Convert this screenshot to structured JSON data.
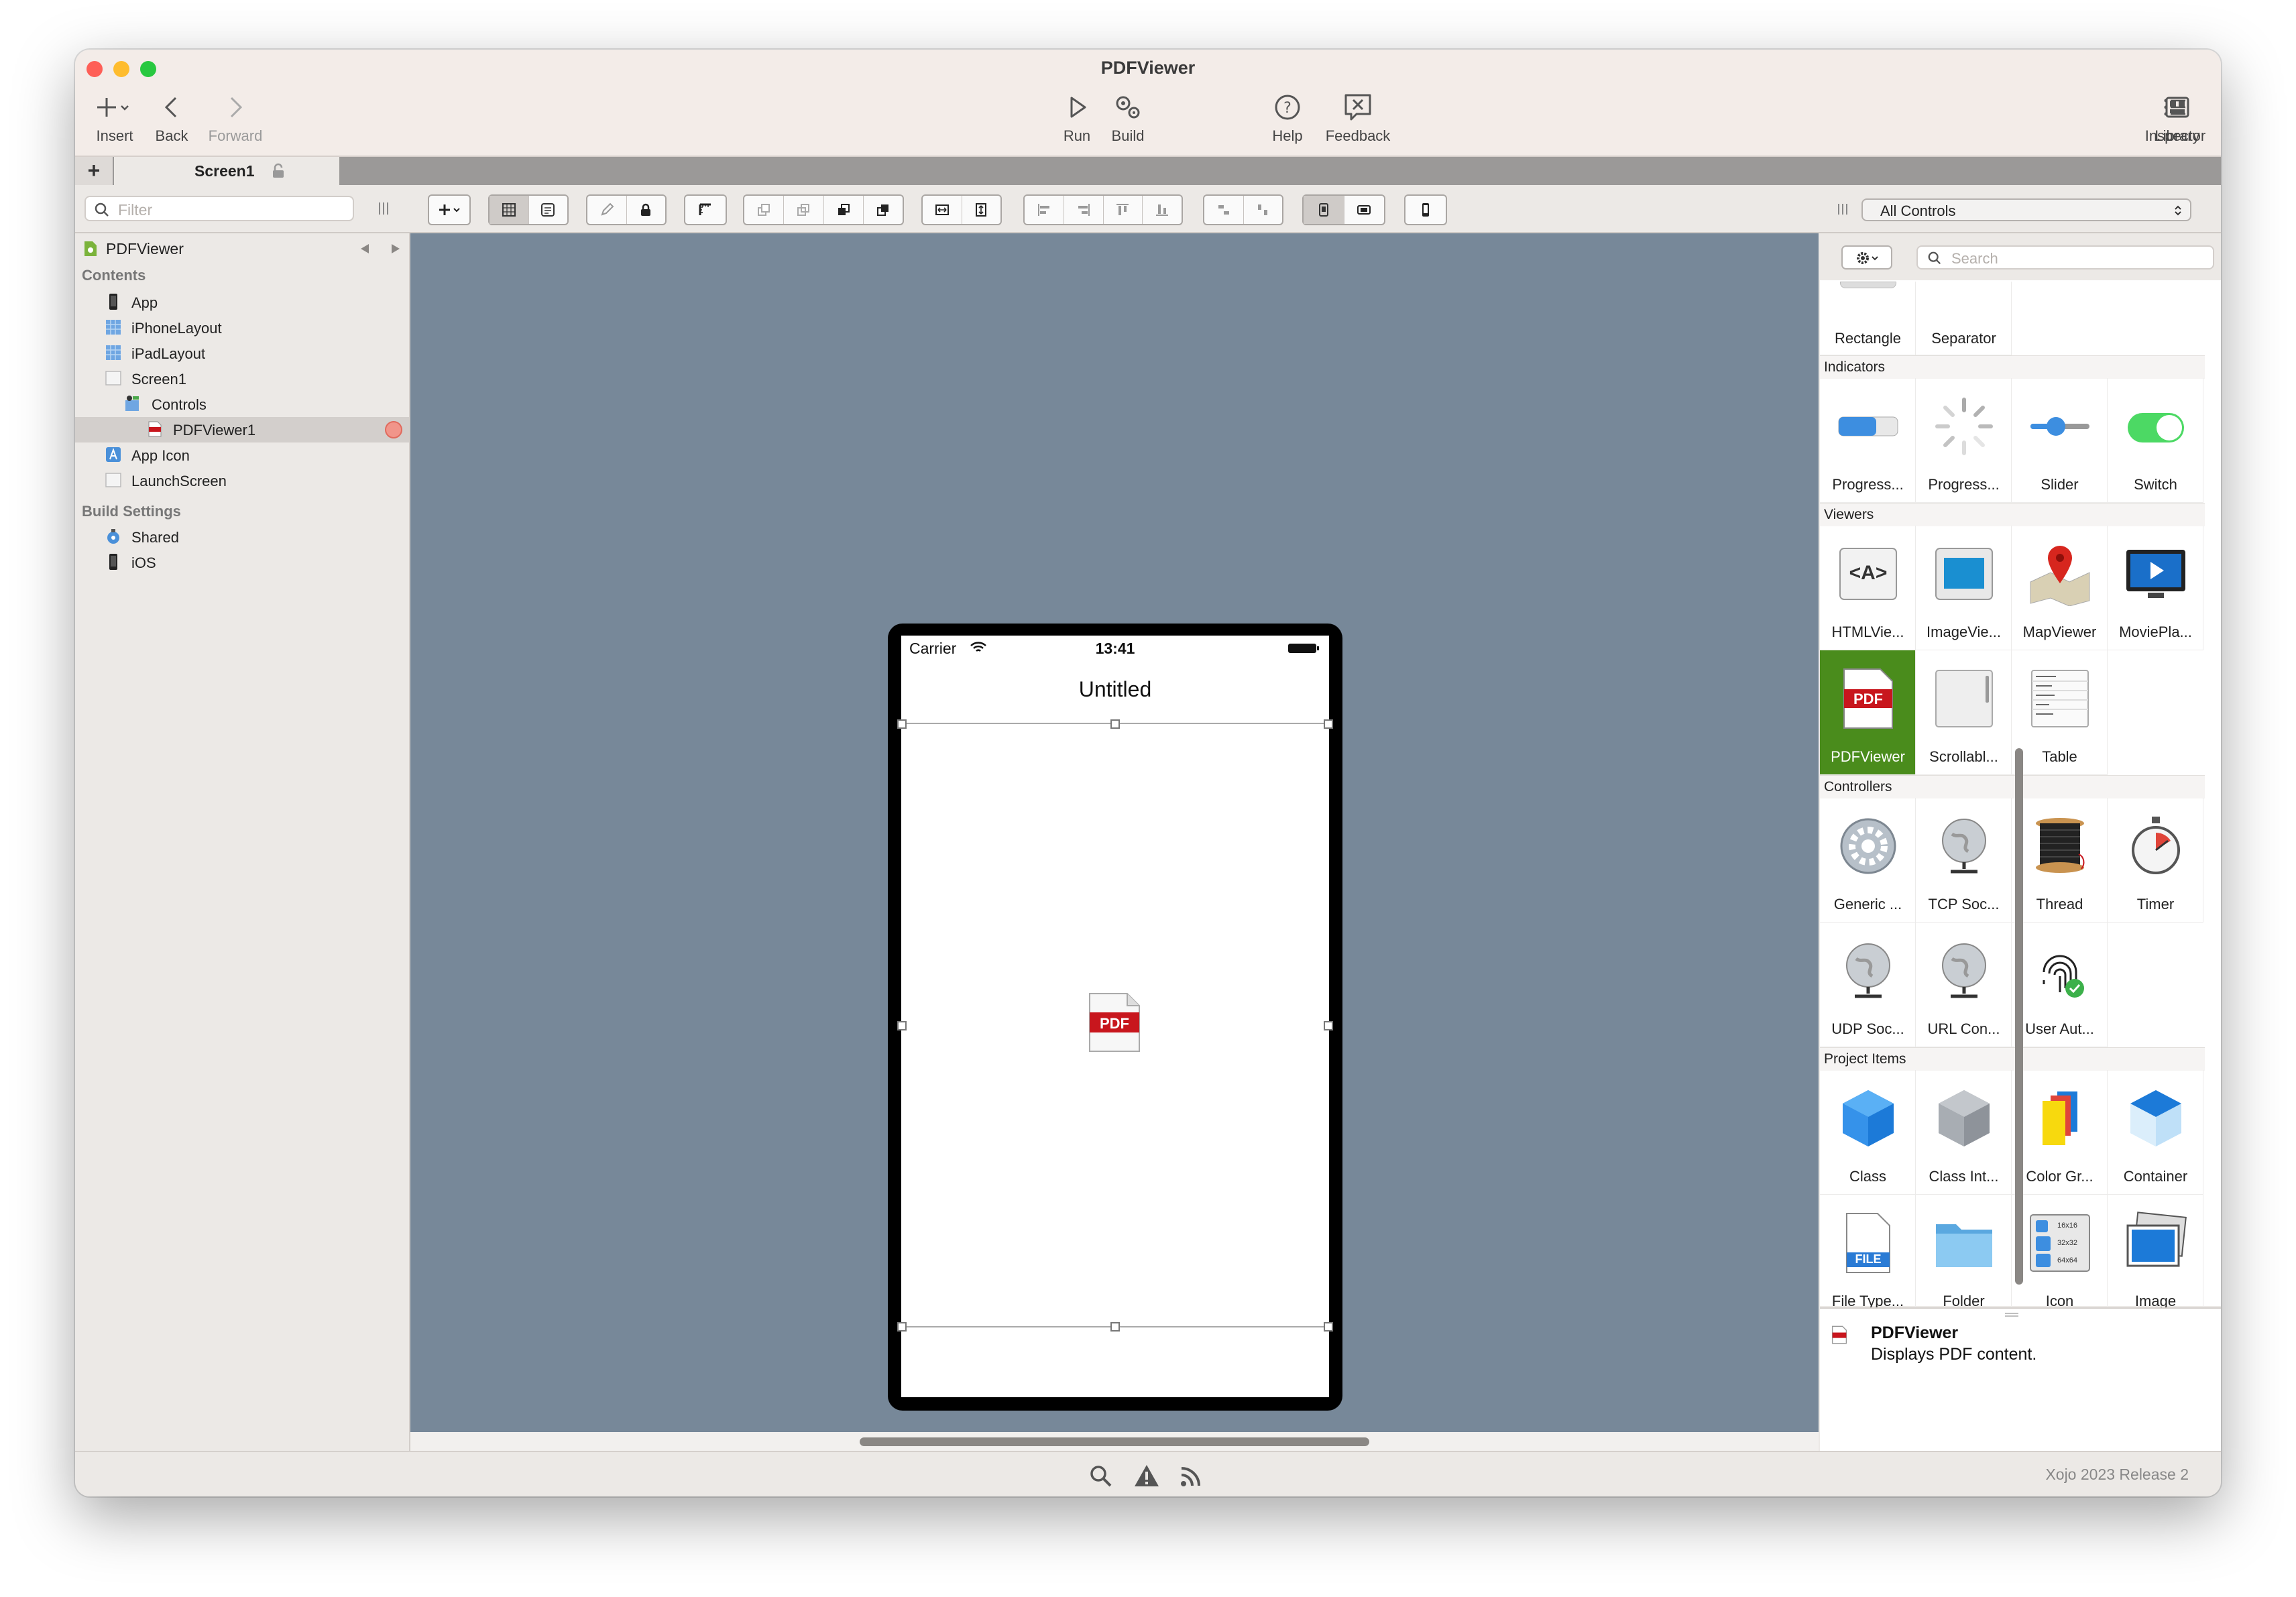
{
  "window": {
    "title": "PDFViewer",
    "close_color": "#fe5f57",
    "minimize_color": "#febc2e",
    "zoom_color": "#28c840"
  },
  "toolbar": {
    "insert": "Insert",
    "back": "Back",
    "forward": "Forward",
    "run": "Run",
    "build": "Build",
    "help": "Help",
    "feedback": "Feedback",
    "library": "Library",
    "inspector": "Inspector"
  },
  "tabs": {
    "plus": "+",
    "active": "Screen1"
  },
  "filter": {
    "placeholder": "Filter"
  },
  "library_select": {
    "value": "All Controls"
  },
  "library_search": {
    "placeholder": "Search"
  },
  "navigator": {
    "project": "PDFViewer",
    "contents_header": "Contents",
    "items": [
      {
        "label": "App",
        "icon": "device-icon"
      },
      {
        "label": "iPhoneLayout",
        "icon": "layout-icon"
      },
      {
        "label": "iPadLayout",
        "icon": "layout-icon"
      },
      {
        "label": "Screen1",
        "icon": "screen-icon"
      },
      {
        "label": "Controls",
        "icon": "controls-icon"
      },
      {
        "label": "PDFViewer1",
        "icon": "pdf-icon"
      },
      {
        "label": "App Icon",
        "icon": "app-icon"
      },
      {
        "label": "LaunchScreen",
        "icon": "screen-icon"
      }
    ],
    "build_header": "Build Settings",
    "build_items": [
      {
        "label": "Shared",
        "icon": "shared-icon"
      },
      {
        "label": "iOS",
        "icon": "device-icon"
      }
    ]
  },
  "phone": {
    "carrier": "Carrier",
    "time": "13:41",
    "nav_title": "Untitled",
    "pdf_badge": "PDF"
  },
  "library": {
    "top_row": [
      "Rectangle",
      "Separator"
    ],
    "groups": [
      {
        "name": "Indicators",
        "items": [
          "Progress...",
          "Progress...",
          "Slider",
          "Switch"
        ]
      },
      {
        "name": "Viewers",
        "items": [
          "HTMLVie...",
          "ImageVie...",
          "MapViewer",
          "MoviePla...",
          "PDFViewer",
          "Scrollabl...",
          "Table"
        ]
      },
      {
        "name": "Controllers",
        "items": [
          "Generic ...",
          "TCP Soc...",
          "Thread",
          "Timer",
          "UDP Soc...",
          "URL Con...",
          "User Aut..."
        ]
      },
      {
        "name": "Project Items",
        "items": [
          "Class",
          "Class Int...",
          "Color Gr...",
          "Container",
          "File Type...",
          "Folder",
          "Icon",
          "Image"
        ]
      }
    ],
    "html_viewer_glyph": "<A>",
    "file_badge": "FILE",
    "icon_sizes": [
      "16x16",
      "32x32",
      "64x64"
    ]
  },
  "description": {
    "name": "PDFViewer",
    "text": "Displays PDF content."
  },
  "status": {
    "version": "Xojo 2023 Release 2"
  },
  "colors": {
    "canvas": "#778899",
    "selection": "#4a8c1c",
    "pdf_red": "#c8161d"
  }
}
